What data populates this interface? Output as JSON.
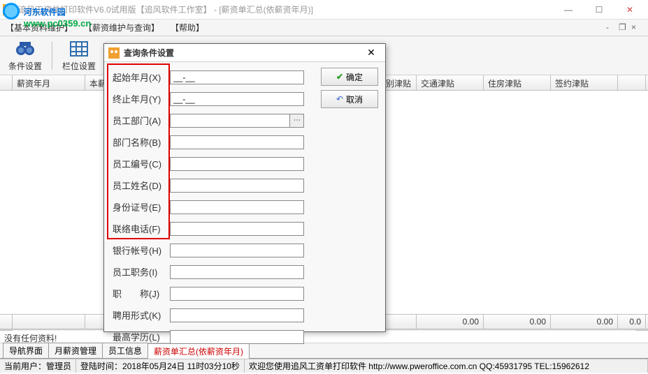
{
  "window": {
    "title": "追风工资单打印软件V6.0试用版【追风软件工作室】 - [薪资单汇总(依薪资年月)]"
  },
  "watermark": {
    "site_name": "河东软件园",
    "url": "www.pc0359.cn"
  },
  "menu": {
    "items": [
      "【基本资料维护】",
      "【薪资维护与查询】",
      "【帮助】"
    ]
  },
  "toolbar": {
    "btn1": "条件设置",
    "btn2": "栏位设置"
  },
  "grid": {
    "headers": [
      "",
      "薪资年月",
      "本薪",
      "别津贴",
      "交通津贴",
      "住房津贴",
      "签约津贴"
    ],
    "footer_vals": [
      "0.00",
      "0.00",
      "0.00",
      "0.0"
    ]
  },
  "info": {
    "no_data": "没有任何资料!"
  },
  "tabs": {
    "items": [
      "导航界面",
      "月薪资管理",
      "员工信息",
      "薪资单汇总(依薪资年月)"
    ],
    "active_index": 3
  },
  "statusbar": {
    "user_label": "当前用户：",
    "user_value": "管理员",
    "login_label": "登陆时间：",
    "login_value": "2018年05月24日 11时03分10秒",
    "welcome": "欢迎您使用追风工资单打印软件 http://www.pweroffice.com.cn QQ:45931795 TEL:15962612"
  },
  "dialog": {
    "title": "查询条件设置",
    "ok": "确定",
    "cancel": "取消",
    "fields": [
      {
        "label": "起始年月(X)",
        "value": "__-__"
      },
      {
        "label": "终止年月(Y)",
        "value": "__-__"
      },
      {
        "label": "员工部门(A)",
        "value": "",
        "lookup": true
      },
      {
        "label": "部门名称(B)",
        "value": ""
      },
      {
        "label": "员工编号(C)",
        "value": ""
      },
      {
        "label": "员工姓名(D)",
        "value": ""
      },
      {
        "label": "身份证号(E)",
        "value": ""
      },
      {
        "label": "联络电话(F)",
        "value": ""
      },
      {
        "label": "银行帐号(H)",
        "value": ""
      },
      {
        "label": "员工职务(I)",
        "value": ""
      },
      {
        "label": "职　　称(J)",
        "value": ""
      },
      {
        "label": "聘用形式(K)",
        "value": ""
      },
      {
        "label": "最高学历(L)",
        "value": ""
      }
    ]
  }
}
